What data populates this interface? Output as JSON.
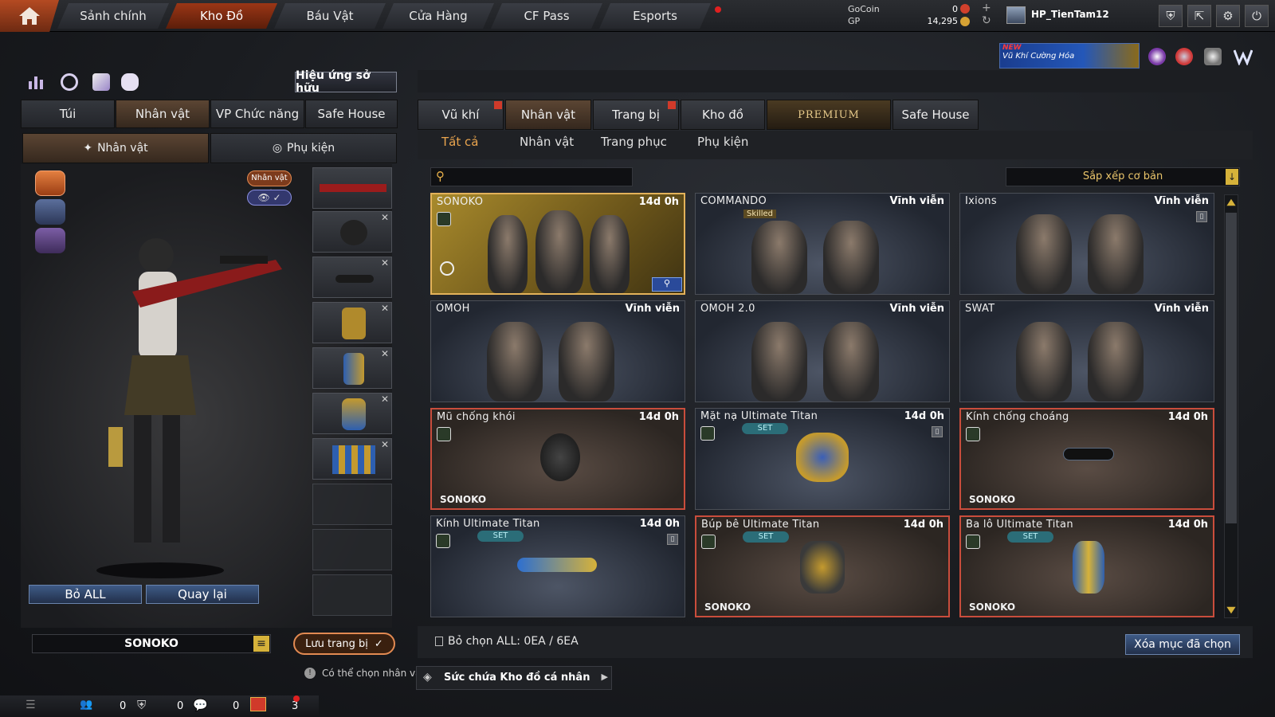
{
  "nav": {
    "tabs": [
      "Sảnh chính",
      "Kho Đồ",
      "Báu Vật",
      "Cửa Hàng",
      "CF Pass",
      "Esports"
    ],
    "currency": {
      "gocoin_label": "GoCoin",
      "gocoin_value": "0",
      "gp_label": "GP",
      "gp_value": "14,295"
    },
    "username": "HP_TienTam12",
    "promo_new": "NEW",
    "promo_text": "Vũ Khí Cường Hóa"
  },
  "left": {
    "effect_button": "Hiệu ứng sở hữu",
    "tabs": [
      "Túi",
      "Nhân vật",
      "VP Chức năng",
      "Safe House"
    ],
    "subtabs": [
      "Nhân vật",
      "Phụ kiện"
    ],
    "badge_character": "Nhân vật",
    "remove_all": "Bỏ ALL",
    "back": "Quay lại",
    "character_name": "SONOKO",
    "save_equip": "Lưu trang bị",
    "hint": "Có thể chọn nhân vật n"
  },
  "right": {
    "tabs": [
      "Vũ khí",
      "Nhân vật",
      "Trang bị",
      "Kho đồ",
      "PREMIUM",
      "Safe House"
    ],
    "subtabs": [
      "Tất cả",
      "Nhân vật",
      "Trang phục",
      "Phụ kiện"
    ],
    "search_placeholder": "",
    "sort_label": "Sắp xếp cơ bản",
    "cards": [
      {
        "name": "SONOKO",
        "time": "14d 0h",
        "owner": "",
        "set": "",
        "badge": ""
      },
      {
        "name": "COMMANDO",
        "time": "Vĩnh viễn",
        "owner": "",
        "set": "",
        "badge": "Skilled"
      },
      {
        "name": "Ixions",
        "time": "Vĩnh viễn",
        "owner": "",
        "set": "",
        "badge": ""
      },
      {
        "name": "OMOH",
        "time": "Vĩnh viễn",
        "owner": "",
        "set": "",
        "badge": ""
      },
      {
        "name": "OMOH 2.0",
        "time": "Vĩnh viễn",
        "owner": "",
        "set": "",
        "badge": ""
      },
      {
        "name": "SWAT",
        "time": "Vĩnh viễn",
        "owner": "",
        "set": "",
        "badge": ""
      },
      {
        "name": "Mũ chống khói",
        "time": "14d 0h",
        "owner": "SONOKO",
        "set": "",
        "badge": ""
      },
      {
        "name": "Mặt nạ Ultimate Titan",
        "time": "14d 0h",
        "owner": "",
        "set": "SET",
        "badge": ""
      },
      {
        "name": "Kính chống choáng",
        "time": "14d 0h",
        "owner": "SONOKO",
        "set": "",
        "badge": ""
      },
      {
        "name": "Kính Ultimate Titan",
        "time": "14d 0h",
        "owner": "",
        "set": "SET",
        "badge": ""
      },
      {
        "name": "Búp bê Ultimate Titan",
        "time": "14d 0h",
        "owner": "SONOKO",
        "set": "SET",
        "badge": ""
      },
      {
        "name": "Ba lô Ultimate Titan",
        "time": "14d 0h",
        "owner": "SONOKO",
        "set": "SET",
        "badge": ""
      }
    ],
    "deselect_text": "Bỏ chọn ALL: 0EA / 6EA",
    "delete_selected": "Xóa mục đã chọn",
    "capacity": "Sức chứa Kho đồ cá nhân"
  },
  "statusbar": {
    "count1": "0",
    "count2": "0",
    "count3": "0",
    "badge": "3"
  }
}
